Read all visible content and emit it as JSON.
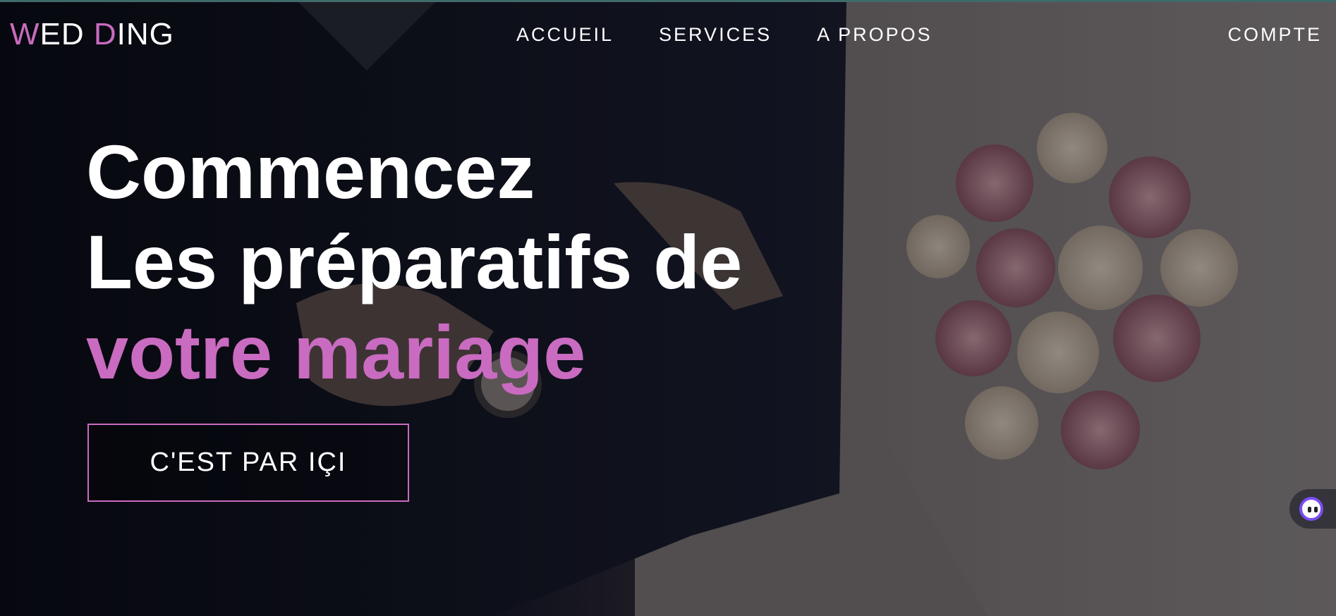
{
  "brand": {
    "logo_part1_accent": "W",
    "logo_part1": "ED ",
    "logo_part2_accent": "D",
    "logo_part2": "ING",
    "accent_color": "#c96bc0"
  },
  "nav": {
    "items": [
      {
        "label": "ACCUEIL"
      },
      {
        "label": "SERVICES"
      },
      {
        "label": "A PROPOS"
      }
    ],
    "account_label": "COMPTE"
  },
  "hero": {
    "line1": "Commencez",
    "line2": "Les préparatifs de",
    "line3": "votre mariage",
    "cta_label": "C'EST PAR IÇI"
  },
  "assistant": {
    "icon": "chat-assistant-icon"
  }
}
